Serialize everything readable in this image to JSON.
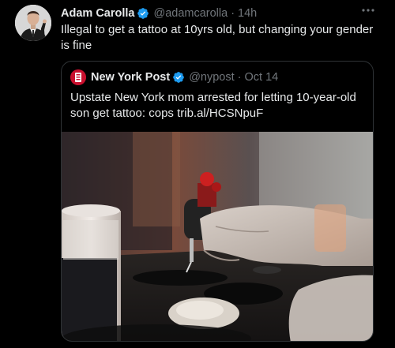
{
  "tweet": {
    "display_name": "Adam Carolla",
    "handle": "@adamcarolla",
    "separator": "·",
    "time": "14h",
    "text": "Illegal to get a tattoo at 10yrs old, but changing your gender is fine",
    "more_icon": "more-icon"
  },
  "quoted_tweet": {
    "display_name": "New York Post",
    "handle": "@nypost",
    "separator": "·",
    "time": "Oct 14",
    "text": "Upstate New York mom arrested for letting 10-year-old son get tattoo: cops trib.al/HCSNpuF"
  },
  "colors": {
    "background": "#000000",
    "text_primary": "#e7e9ea",
    "text_secondary": "#71767b",
    "verified": "#1d9bf0",
    "border": "#2f3336",
    "nypost_red": "#c8102e"
  }
}
